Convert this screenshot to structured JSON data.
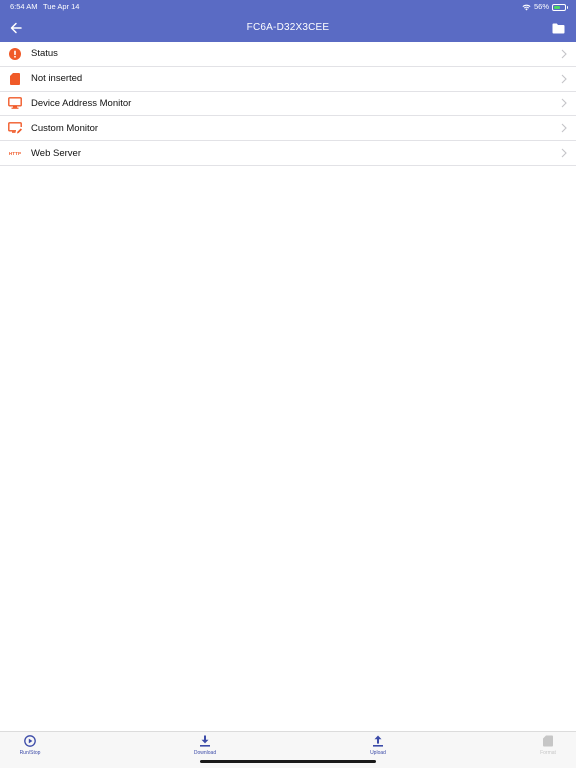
{
  "status_bar": {
    "time": "6:54 AM",
    "date": "Tue Apr 14",
    "battery_percent": "56%",
    "battery_level": 0.56,
    "icons": [
      "wifi-icon",
      "battery-icon"
    ]
  },
  "nav": {
    "title": "FC6A-D32X3CEE",
    "back_icon": "arrow-left-icon",
    "folder_icon": "folder-icon"
  },
  "colors": {
    "header_bg": "#5a6bc4",
    "accent_orange": "#f05a28",
    "tab_active": "#3c4ba8",
    "tab_disabled": "#c6c6c6"
  },
  "menu": {
    "items": [
      {
        "label": "Status",
        "icon": "info-icon"
      },
      {
        "label": "Not inserted",
        "icon": "sd-card-icon"
      },
      {
        "label": "Device Address Monitor",
        "icon": "monitor-icon"
      },
      {
        "label": "Custom Monitor",
        "icon": "monitor-edit-icon"
      },
      {
        "label": "Web Server",
        "icon": "http-icon",
        "icon_text": "HTTP"
      }
    ]
  },
  "tabs": [
    {
      "label": "Run/Stop",
      "icon": "play-circle-icon",
      "enabled": true
    },
    {
      "label": "Download",
      "icon": "download-icon",
      "enabled": true
    },
    {
      "label": "Upload",
      "icon": "upload-icon",
      "enabled": true
    },
    {
      "label": "Format",
      "icon": "sd-card-icon",
      "enabled": false
    }
  ]
}
